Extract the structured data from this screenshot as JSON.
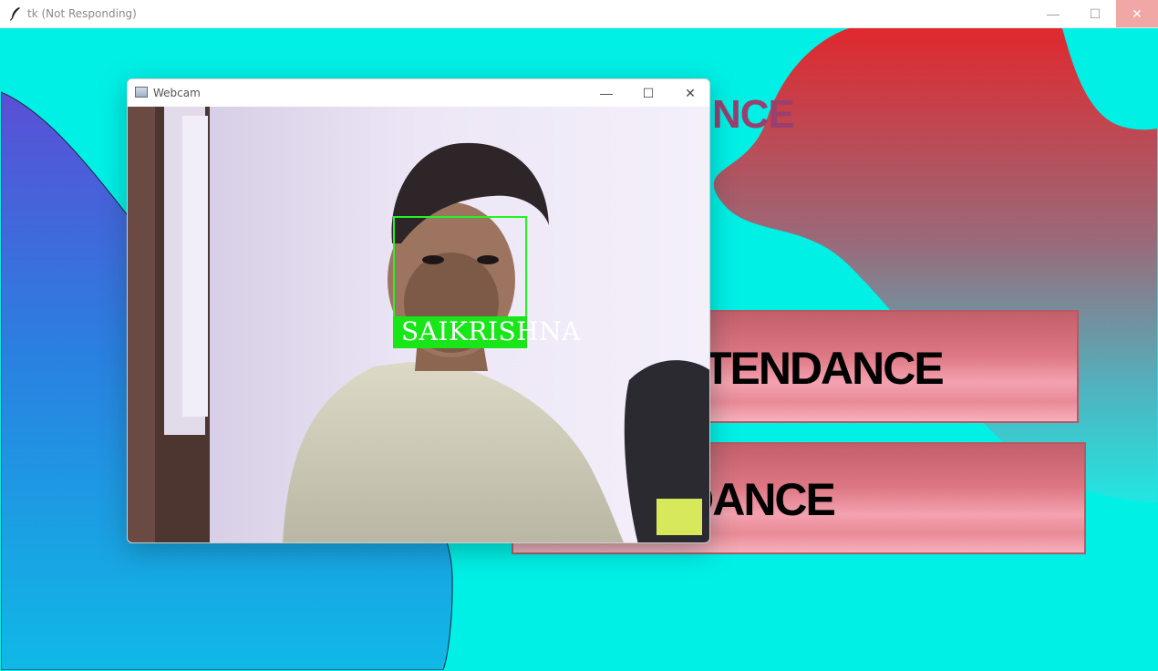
{
  "window": {
    "title": "tk (Not Responding)",
    "controls": {
      "minimize": "—",
      "maximize": "☐",
      "close": "✕"
    }
  },
  "app": {
    "heading_fragment": "NCE",
    "buttons": {
      "take_attendance": "ATTENDANCE",
      "view_attendance": "NDANCE"
    }
  },
  "webcam_window": {
    "title": "Webcam",
    "controls": {
      "minimize": "—",
      "maximize": "☐",
      "close": "✕"
    },
    "detected_name": "SAIKRISHNA"
  },
  "colors": {
    "background": "#00f0e6",
    "blue_blob": "#1e7fe0",
    "red_blob": "#d8363a",
    "button_pink": "#e98a96",
    "face_box": "#22f522"
  },
  "icons": {
    "app_icon": "feather-icon",
    "webcam_icon": "window-icon"
  }
}
